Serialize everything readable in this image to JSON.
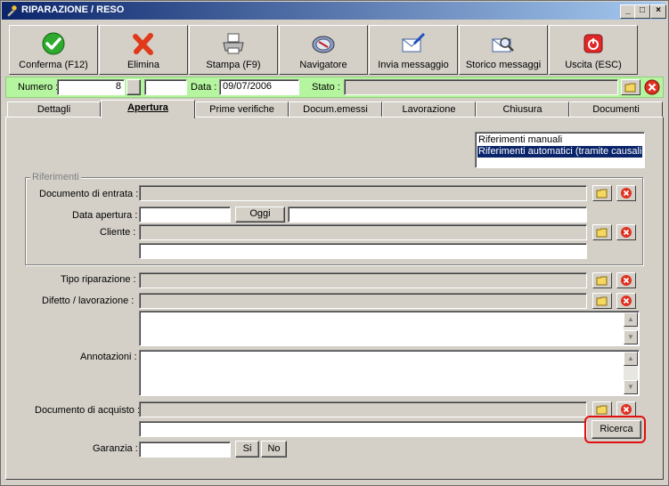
{
  "window": {
    "title": "RIPARAZIONE / RESO"
  },
  "titlebar_buttons": {
    "minimize": "_",
    "maximize": "□",
    "close": "×"
  },
  "toolbar": [
    {
      "label": "Conferma (F12)",
      "icon": "checkmark-icon"
    },
    {
      "label": "Elimina",
      "icon": "delete-x-icon"
    },
    {
      "label": "Stampa (F9)",
      "icon": "printer-icon"
    },
    {
      "label": "Navigatore",
      "icon": "compass-icon"
    },
    {
      "label": "Invia messaggio",
      "icon": "mail-send-icon"
    },
    {
      "label": "Storico messaggi",
      "icon": "mail-search-icon"
    },
    {
      "label": "Uscita (ESC)",
      "icon": "power-exit-icon"
    }
  ],
  "header": {
    "numero_label": "Numero :",
    "numero_value": "8",
    "numero_suffix": "",
    "data_label": "Data :",
    "data_value": "09/07/2006",
    "stato_label": "Stato :",
    "stato_value": ""
  },
  "tabs": [
    "Dettagli",
    "Apertura",
    "Prime verifiche",
    "Docum.emessi",
    "Lavorazione",
    "Chiusura",
    "Documenti"
  ],
  "active_tab": "Apertura",
  "riferimenti_list": [
    "Riferimenti manuali",
    "Riferimenti automatici (tramite causali abbinate)"
  ],
  "riferimenti": {
    "group_label": "Riferimenti",
    "documento_entrata_label": "Documento di entrata :",
    "documento_entrata_value": "",
    "data_apertura_label": "Data apertura :",
    "data_apertura_value": "",
    "oggi_button": "Oggi",
    "data_apertura_note": "",
    "cliente_label": "Cliente :",
    "cliente_value": "",
    "cliente_detail": ""
  },
  "form": {
    "tipo_riparazione_label": "Tipo riparazione :",
    "difetto_label": "Difetto / lavorazione :",
    "annotazioni_label": "Annotazioni :",
    "documento_acquisto_label": "Documento di acquisto :",
    "ricerca_button": "Ricerca",
    "garanzia_label": "Garanzia :",
    "si_button": "Si",
    "no_button": "No"
  }
}
